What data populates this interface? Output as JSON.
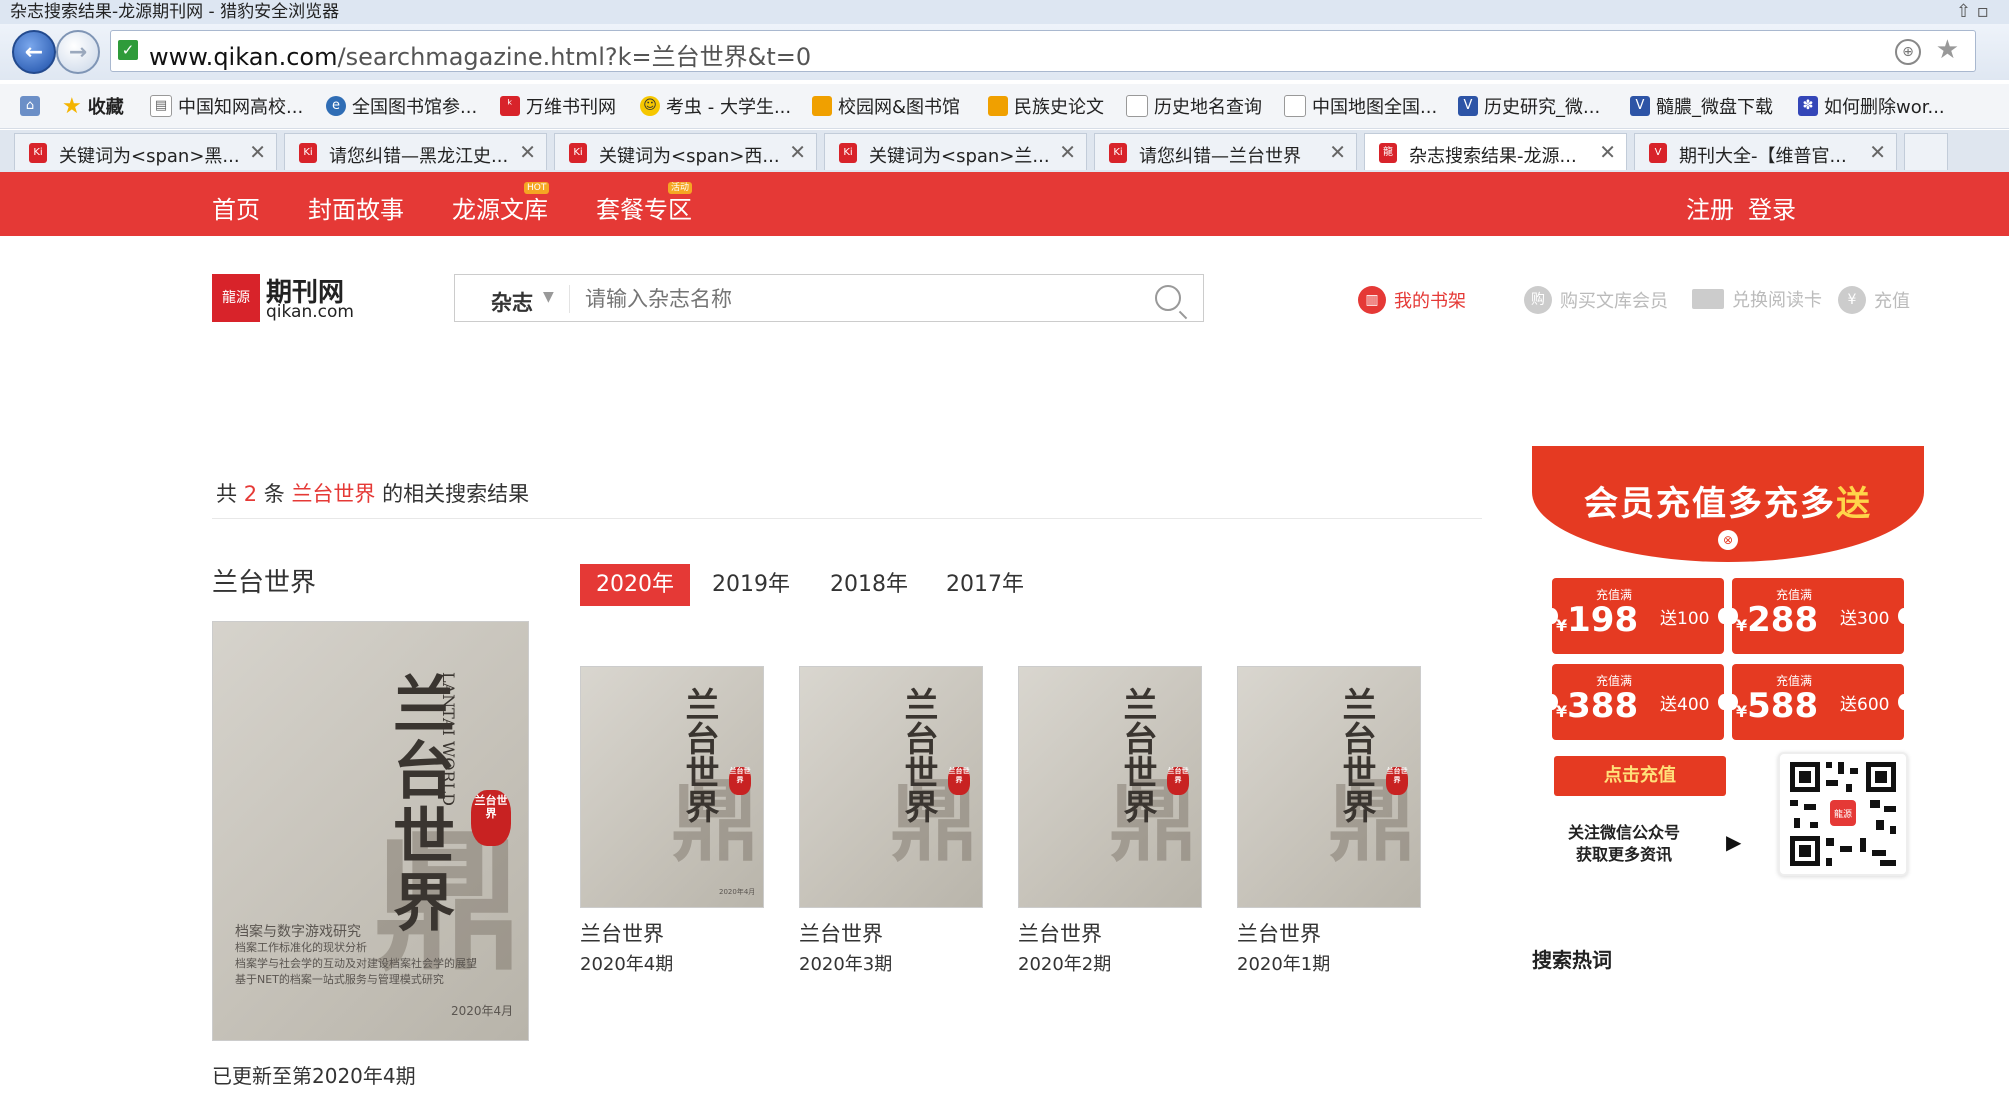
{
  "window": {
    "title": "杂志搜索结果-龙源期刊网 - 猎豹安全浏览器"
  },
  "address": {
    "domain": "www.qikan.com",
    "path": "/searchmagazine.html?k=兰台世界&t=0"
  },
  "bookmarks": [
    {
      "label": "收藏",
      "color": "#f4b400"
    },
    {
      "label": "中国知网高校...",
      "color": "#8a8a8a"
    },
    {
      "label": "全国图书馆参...",
      "color": "#2f6db5"
    },
    {
      "label": "万维书刊网",
      "color": "#d8232a"
    },
    {
      "label": "考虫 - 大学生...",
      "color": "#f6c700"
    },
    {
      "label": "校园网&图书馆",
      "color": "#f0a000"
    },
    {
      "label": "民族史论文",
      "color": "#f0a000"
    },
    {
      "label": "历史地名查询",
      "color": "#9aa3ad"
    },
    {
      "label": "中国地图全国...",
      "color": "#9aa3ad"
    },
    {
      "label": "历史研究_微...",
      "color": "#2d54a6"
    },
    {
      "label": "髓膿_微盘下载",
      "color": "#2d54a6"
    },
    {
      "label": "如何删除wor...",
      "color": "#3446b8"
    }
  ],
  "tabs": [
    {
      "label": "关键词为<span>黑..."
    },
    {
      "label": "请您纠错—黑龙江史..."
    },
    {
      "label": "关键词为<span>西..."
    },
    {
      "label": "关键词为<span>兰..."
    },
    {
      "label": "请您纠错—兰台世界"
    },
    {
      "label": "杂志搜索结果-龙源..."
    },
    {
      "label": "期刊大全-【维普官..."
    }
  ],
  "nav": {
    "home": "首页",
    "cover": "封面故事",
    "library": "龙源文库",
    "library_badge": "HOT",
    "package": "套餐专区",
    "package_badge": "活动",
    "register": "注册",
    "login": "登录"
  },
  "logo": {
    "mark": "龍源",
    "cn": "期刊网",
    "en": "qikan.com"
  },
  "search": {
    "category": "杂志",
    "placeholder": "请输入杂志名称"
  },
  "header_links": {
    "shelf": "我的书架",
    "buy": "购买文库会员",
    "redeem": "兑换阅读卡",
    "recharge": "充值"
  },
  "results": {
    "prefix": "共",
    "count": "2",
    "unit": "条",
    "keyword": "兰台世界",
    "suffix": "的相关搜索结果"
  },
  "magazine": {
    "name": "兰台世界",
    "years": [
      "2020年",
      "2019年",
      "2018年",
      "2017年"
    ],
    "updated": "已更新至第2020年4期",
    "cover": {
      "title": "兰台世界",
      "en": "LANTAI WORLD",
      "seal": "兰台世界",
      "lines": [
        "档案与数字游戏研究",
        "档案工作标准化的现状分析",
        "档案学与社会学的互动及对建设档案社会学的展望",
        "基于NET的档案一站式服务与管理模式研究"
      ],
      "date": "2020年4月"
    },
    "issues": [
      {
        "name": "兰台世界",
        "issue": "2020年4期"
      },
      {
        "name": "兰台世界",
        "issue": "2020年3期"
      },
      {
        "name": "兰台世界",
        "issue": "2020年2期"
      },
      {
        "name": "兰台世界",
        "issue": "2020年1期"
      }
    ]
  },
  "promo": {
    "headline_a": "会员充值多充多",
    "headline_b": "送",
    "coupons": [
      {
        "small": "充值满",
        "value": "198",
        "gift": "送100"
      },
      {
        "small": "充值满",
        "value": "288",
        "gift": "送300"
      },
      {
        "small": "充值满",
        "value": "388",
        "gift": "送400"
      },
      {
        "small": "充值满",
        "value": "588",
        "gift": "送600"
      }
    ],
    "cta": "点击充值",
    "wechat_line1": "关注微信公众号",
    "wechat_line2": "获取更多资讯"
  },
  "hot": {
    "title": "搜索热词"
  }
}
